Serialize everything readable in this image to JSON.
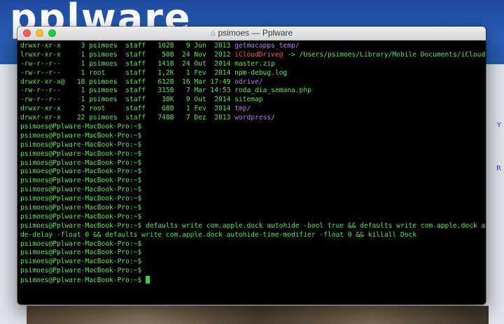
{
  "site": {
    "logo_text": "pplware",
    "edge_letters": [
      "Y",
      "R"
    ]
  },
  "window": {
    "title": "psimoes — Pplware",
    "icon": "home-icon"
  },
  "terminal": {
    "prompt": "psimoes@Pplware-MacBook-Pro:~$",
    "listing": [
      {
        "perms": "drwxr-xr-x ",
        "links": "3",
        "owner": "psimoes",
        "group": "staff",
        "size": "102B",
        "date": "9 Jun  2013",
        "name": "getmacapps_temp",
        "suffix": "/",
        "kind": "dir"
      },
      {
        "perms": "lrwxr-xr-x ",
        "links": "1",
        "owner": "psimoes",
        "group": "staff",
        "size": "50B",
        "date": "24 Nov  2012",
        "name": "iCloudDrive@",
        "suffix": " -> /Users/psimoes/Library/Mobile Documents/iCloudDrive",
        "kind": "link"
      },
      {
        "perms": "-rw-r--r-- ",
        "links": "1",
        "owner": "psimoes",
        "group": "staff",
        "size": "141B",
        "date": "24 Out  2014",
        "name": "master.zip",
        "suffix": "",
        "kind": "file"
      },
      {
        "perms": "-rw-r--r-- ",
        "links": "1",
        "owner": "root",
        "group": "staff",
        "size": "1,2K",
        "date": "1 Fev  2014",
        "name": "npm-debug.log",
        "suffix": "",
        "kind": "file"
      },
      {
        "perms": "drwxr-xr-x@",
        "links": "18",
        "owner": "psimoes",
        "group": "staff",
        "size": "612B",
        "date": "16 Mar 17:49",
        "name": "odrive",
        "suffix": "/",
        "kind": "dir"
      },
      {
        "perms": "-rw-r--r-- ",
        "links": "1",
        "owner": "psimoes",
        "group": "staff",
        "size": "315B",
        "date": "7 Mar 14:53",
        "name": "roda_dia_semana.php",
        "suffix": "",
        "kind": "file"
      },
      {
        "perms": "-rw-r--r-- ",
        "links": "1",
        "owner": "psimoes",
        "group": "staff",
        "size": "38K",
        "date": "9 Out  2014",
        "name": "sitemap",
        "suffix": "",
        "kind": "file"
      },
      {
        "perms": "drwxr-xr-x ",
        "links": "2",
        "owner": "root",
        "group": "staff",
        "size": "68B",
        "date": "1 Fev  2014",
        "name": "tmp",
        "suffix": "/",
        "kind": "dir"
      },
      {
        "perms": "drwxr-xr-x ",
        "links": "22",
        "owner": "psimoes",
        "group": "staff",
        "size": "748B",
        "date": "7 Dez  2013",
        "name": "wordpress",
        "suffix": "/",
        "kind": "dir"
      }
    ],
    "empty_prompts_before": 11,
    "command_line_1": " defaults write com.apple.dock autohide -bool true && defaults write com.apple.dock autohi",
    "command_line_2": "de-delay -float 0 && defaults write com.apple.dock autohide-time-modifier -float 0 && killall Dock",
    "empty_prompts_after": 5,
    "colors": {
      "text": "#58e850",
      "directory": "#b67de8",
      "symlink": "#ff5a5a",
      "background": "#000000"
    }
  }
}
